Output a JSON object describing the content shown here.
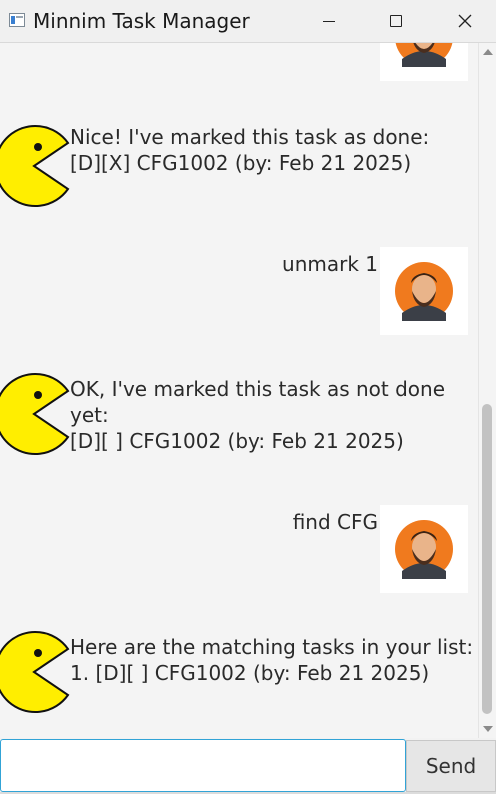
{
  "window": {
    "title": "Minnim Task Manager"
  },
  "messages": [
    {
      "sender": "user",
      "text": ""
    },
    {
      "sender": "bot",
      "text": "Nice! I've marked this task as done:\n[D][X] CFG1002 (by: Feb 21 2025)"
    },
    {
      "sender": "user",
      "text": "unmark 1"
    },
    {
      "sender": "bot",
      "text": "OK, I've marked this task as not done\nyet:\n[D][ ] CFG1002 (by: Feb 21 2025)"
    },
    {
      "sender": "user",
      "text": "find CFG"
    },
    {
      "sender": "bot",
      "text": "Here are the matching tasks in your list:\n1. [D][ ] CFG1002 (by: Feb 21 2025)"
    }
  ],
  "input": {
    "value": "",
    "placeholder": ""
  },
  "send_label": "Send",
  "colors": {
    "bot_avatar": "#ffee00",
    "user_avatar_bg": "#f07a1e",
    "input_focus": "#31a3d6"
  },
  "icons": {
    "bot_avatar": "pacman-icon",
    "user_avatar": "bearded-man-icon"
  }
}
